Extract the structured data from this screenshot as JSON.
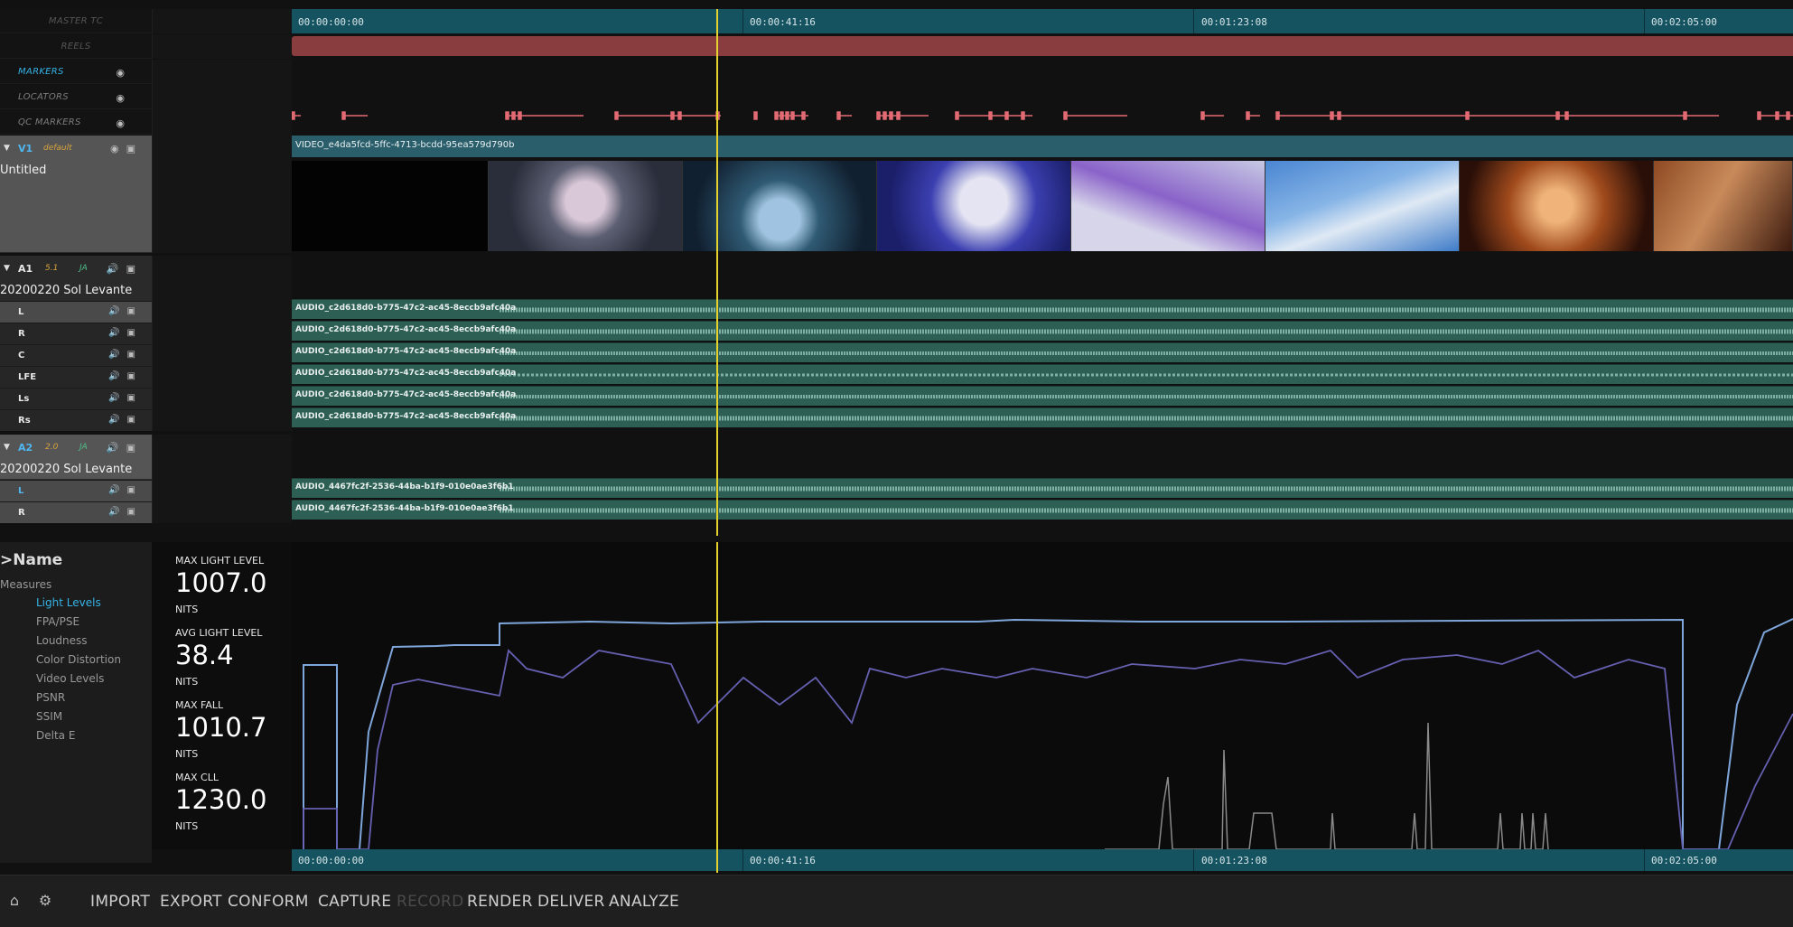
{
  "ruler": {
    "timecodes": [
      "00:00:00:00",
      "00:00:41:16",
      "00:01:23:08",
      "00:02:05:00"
    ]
  },
  "headers": {
    "master_tc": "MASTER TC",
    "reels": "REELS",
    "markers": "MARKERS",
    "locators": "LOCATORS",
    "qc_markers": "QC MARKERS"
  },
  "tracks": {
    "v1": {
      "name": "V1",
      "sub": "default",
      "title": "Untitled",
      "clip": "VIDEO_e4da5fcd-5ffc-4713-bcdd-95ea579d790b"
    },
    "a1": {
      "name": "A1",
      "sub": "5.1",
      "lang": "JA",
      "title": "20200220 Sol Levante",
      "channels": [
        "L",
        "R",
        "C",
        "LFE",
        "Ls",
        "Rs"
      ],
      "clip": "AUDIO_c2d618d0-b775-47c2-ac45-8eccb9afc40a"
    },
    "a2": {
      "name": "A2",
      "sub": "2.0",
      "lang": "JA",
      "title": "20200220 Sol Levante",
      "channels": [
        "L",
        "R"
      ],
      "clip": "AUDIO_4467fc2f-2536-44ba-b1f9-010e0ae3f6b1"
    }
  },
  "panel": {
    "title": ">Name",
    "measures_label": "Measures",
    "items": [
      "Light Levels",
      "FPA/PSE",
      "Loudness",
      "Color Distortion",
      "Video Levels",
      "PSNR",
      "SSIM",
      "Delta E"
    ],
    "active_item": "Light Levels"
  },
  "metrics": [
    {
      "label": "MAX LIGHT LEVEL",
      "value": "1007.0",
      "unit": "NITS"
    },
    {
      "label": "AVG LIGHT LEVEL",
      "value": "38.4",
      "unit": "NITS"
    },
    {
      "label": "MAX FALL",
      "value": "1010.7",
      "unit": "NITS"
    },
    {
      "label": "MAX CLL",
      "value": "1230.0",
      "unit": "NITS"
    }
  ],
  "toolbar": {
    "buttons": [
      "IMPORT",
      "EXPORT",
      "CONFORM",
      "CAPTURE",
      "RECORD",
      "RENDER",
      "DELIVER",
      "ANALYZE"
    ],
    "disabled": "RECORD"
  },
  "colors": {
    "accent": "#35b3e6",
    "ruler": "#14535f",
    "reels": "#8a3d3e",
    "marker": "#e26a72",
    "playhead": "#e6d22e",
    "audio_clip": "#2e5f55",
    "graph_max": "#7fa6db",
    "graph_avg": "#6560b0",
    "graph_spike": "#8a8a8a"
  }
}
